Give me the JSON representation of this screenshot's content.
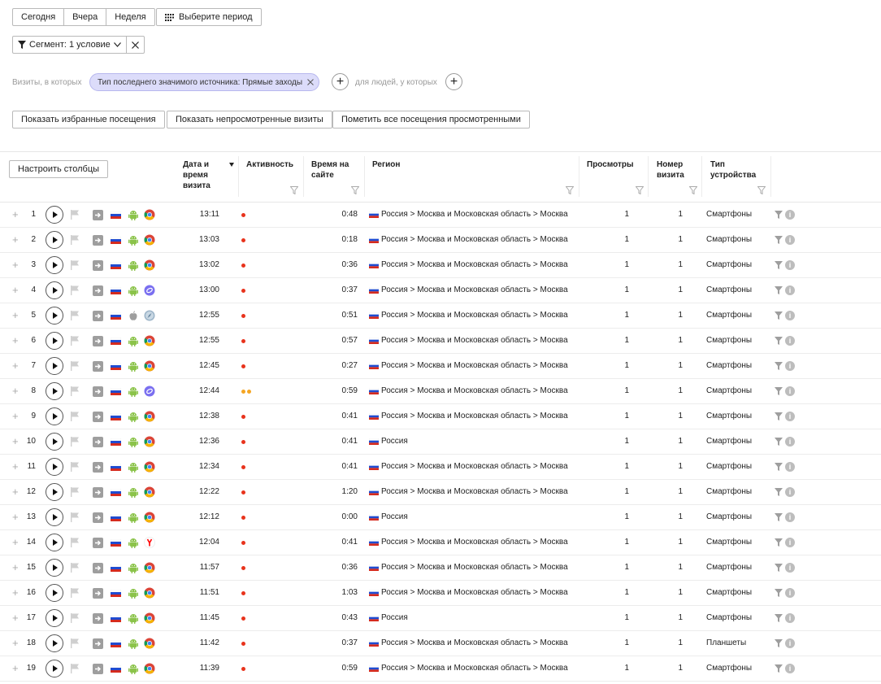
{
  "period": {
    "today": "Сегодня",
    "yesterday": "Вчера",
    "week": "Неделя",
    "choose": "Выберите период"
  },
  "segment": {
    "label": "Сегмент: 1 условие"
  },
  "conditions": {
    "visits_label": "Визиты, в которых",
    "chip": "Тип последнего значимого источника: Прямые заходы",
    "people_label": "для людей, у которых"
  },
  "actions": {
    "favorites": "Показать избранные посещения",
    "unviewed": "Показать непросмотренные визиты",
    "mark_all": "Пометить все посещения просмотренными"
  },
  "table": {
    "configure_columns": "Настроить столбцы",
    "headers": {
      "date": [
        "Дата и",
        "время",
        "визита"
      ],
      "activity": "Активность",
      "duration": [
        "Время на",
        "сайте"
      ],
      "region": "Регион",
      "views": "Просмотры",
      "visit_no": [
        "Номер",
        "визита"
      ],
      "device": [
        "Тип",
        "устройства"
      ]
    },
    "rows": [
      {
        "n": "1",
        "time": "13:11",
        "act": [
          "red"
        ],
        "dur": "0:48",
        "region": "Россия > Москва и Московская область > Москва",
        "views": "1",
        "visit": "1",
        "device": "Смартфоны",
        "os": "android",
        "browser": "chrome"
      },
      {
        "n": "2",
        "time": "13:03",
        "act": [
          "red"
        ],
        "dur": "0:18",
        "region": "Россия > Москва и Московская область > Москва",
        "views": "1",
        "visit": "1",
        "device": "Смартфоны",
        "os": "android",
        "browser": "chrome"
      },
      {
        "n": "3",
        "time": "13:02",
        "act": [
          "red"
        ],
        "dur": "0:36",
        "region": "Россия > Москва и Московская область > Москва",
        "views": "1",
        "visit": "1",
        "device": "Смартфоны",
        "os": "android",
        "browser": "chrome"
      },
      {
        "n": "4",
        "time": "13:00",
        "act": [
          "red"
        ],
        "dur": "0:37",
        "region": "Россия > Москва и Московская область > Москва",
        "views": "1",
        "visit": "1",
        "device": "Смартфоны",
        "os": "android",
        "browser": "samsung"
      },
      {
        "n": "5",
        "time": "12:55",
        "act": [
          "red"
        ],
        "dur": "0:51",
        "region": "Россия > Москва и Московская область > Москва",
        "views": "1",
        "visit": "1",
        "device": "Смартфоны",
        "os": "apple",
        "browser": "safari"
      },
      {
        "n": "6",
        "time": "12:55",
        "act": [
          "red"
        ],
        "dur": "0:57",
        "region": "Россия > Москва и Московская область > Москва",
        "views": "1",
        "visit": "1",
        "device": "Смартфоны",
        "os": "android",
        "browser": "chrome"
      },
      {
        "n": "7",
        "time": "12:45",
        "act": [
          "red"
        ],
        "dur": "0:27",
        "region": "Россия > Москва и Московская область > Москва",
        "views": "1",
        "visit": "1",
        "device": "Смартфоны",
        "os": "android",
        "browser": "chrome"
      },
      {
        "n": "8",
        "time": "12:44",
        "act": [
          "orange",
          "orange"
        ],
        "dur": "0:59",
        "region": "Россия > Москва и Московская область > Москва",
        "views": "1",
        "visit": "1",
        "device": "Смартфоны",
        "os": "android",
        "browser": "samsung"
      },
      {
        "n": "9",
        "time": "12:38",
        "act": [
          "red"
        ],
        "dur": "0:41",
        "region": "Россия > Москва и Московская область > Москва",
        "views": "1",
        "visit": "1",
        "device": "Смартфоны",
        "os": "android",
        "browser": "chrome"
      },
      {
        "n": "10",
        "time": "12:36",
        "act": [
          "red"
        ],
        "dur": "0:41",
        "region": "Россия",
        "views": "1",
        "visit": "1",
        "device": "Смартфоны",
        "os": "android",
        "browser": "chrome"
      },
      {
        "n": "11",
        "time": "12:34",
        "act": [
          "red"
        ],
        "dur": "0:41",
        "region": "Россия > Москва и Московская область > Москва",
        "views": "1",
        "visit": "1",
        "device": "Смартфоны",
        "os": "android",
        "browser": "chrome"
      },
      {
        "n": "12",
        "time": "12:22",
        "act": [
          "red"
        ],
        "dur": "1:20",
        "region": "Россия > Москва и Московская область > Москва",
        "views": "1",
        "visit": "1",
        "device": "Смартфоны",
        "os": "android",
        "browser": "chrome"
      },
      {
        "n": "13",
        "time": "12:12",
        "act": [
          "red"
        ],
        "dur": "0:00",
        "region": "Россия",
        "views": "1",
        "visit": "1",
        "device": "Смартфоны",
        "os": "android",
        "browser": "chrome"
      },
      {
        "n": "14",
        "time": "12:04",
        "act": [
          "red"
        ],
        "dur": "0:41",
        "region": "Россия > Москва и Московская область > Москва",
        "views": "1",
        "visit": "1",
        "device": "Смартфоны",
        "os": "android",
        "browser": "yandex"
      },
      {
        "n": "15",
        "time": "11:57",
        "act": [
          "red"
        ],
        "dur": "0:36",
        "region": "Россия > Москва и Московская область > Москва",
        "views": "1",
        "visit": "1",
        "device": "Смартфоны",
        "os": "android",
        "browser": "chrome"
      },
      {
        "n": "16",
        "time": "11:51",
        "act": [
          "red"
        ],
        "dur": "1:03",
        "region": "Россия > Москва и Московская область > Москва",
        "views": "1",
        "visit": "1",
        "device": "Смартфоны",
        "os": "android",
        "browser": "chrome"
      },
      {
        "n": "17",
        "time": "11:45",
        "act": [
          "red"
        ],
        "dur": "0:43",
        "region": "Россия",
        "views": "1",
        "visit": "1",
        "device": "Смартфоны",
        "os": "android",
        "browser": "chrome"
      },
      {
        "n": "18",
        "time": "11:42",
        "act": [
          "red"
        ],
        "dur": "0:37",
        "region": "Россия > Москва и Московская область > Москва",
        "views": "1",
        "visit": "1",
        "device": "Планшеты",
        "os": "android",
        "browser": "chrome"
      },
      {
        "n": "19",
        "time": "11:39",
        "act": [
          "red"
        ],
        "dur": "0:59",
        "region": "Россия > Москва и Московская область > Москва",
        "views": "1",
        "visit": "1",
        "device": "Смартфоны",
        "os": "android",
        "browser": "chrome"
      }
    ]
  },
  "colors": {
    "activity_red": "#e8331c",
    "activity_orange": "#f5a623",
    "chip_bg": "#dcdcfa"
  }
}
